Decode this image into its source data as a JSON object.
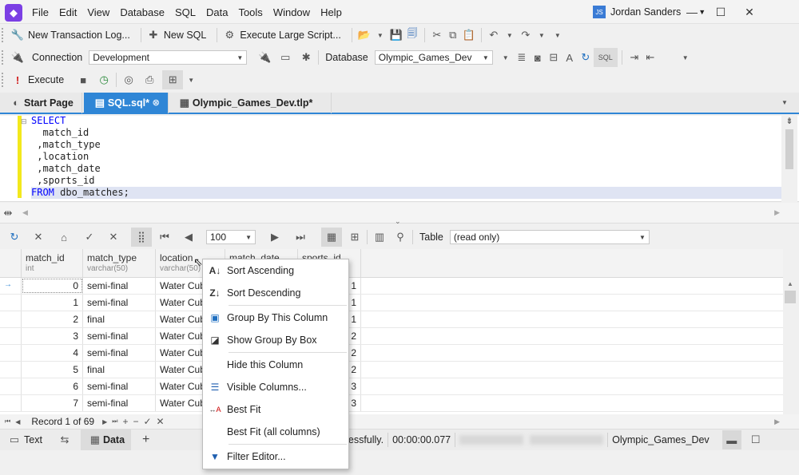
{
  "app": {
    "user": "Jordan Sanders",
    "user_initials": "JS"
  },
  "menu": [
    "File",
    "Edit",
    "View",
    "Database",
    "SQL",
    "Data",
    "Tools",
    "Window",
    "Help"
  ],
  "toolbar1": {
    "new_transaction_log": "New Transaction Log...",
    "new_sql": "New SQL",
    "execute_large_script": "Execute Large Script..."
  },
  "toolbar2": {
    "connection_label": "Connection",
    "connection_value": "Development",
    "database_label": "Database",
    "database_value": "Olympic_Games_Dev"
  },
  "toolbar3": {
    "execute": "Execute"
  },
  "tabs": [
    {
      "label": "Start Page"
    },
    {
      "label": "SQL.sql*"
    },
    {
      "label": "Olympic_Games_Dev.tlp*"
    }
  ],
  "editor": {
    "lines": [
      "SELECT",
      "  match_id",
      " ,match_type",
      " ,location",
      " ,match_date",
      " ,sports_id"
    ]
  },
  "editor_from": {
    "kw": "FROM",
    "rest": " dbo_matches;"
  },
  "grid_toolbar": {
    "page_size": "100",
    "table_label": "Table",
    "table_mode": "(read only)"
  },
  "grid": {
    "columns": [
      {
        "name": "match_id",
        "type": "int"
      },
      {
        "name": "match_type",
        "type": "varchar(50)"
      },
      {
        "name": "location",
        "type": "varchar(50)"
      },
      {
        "name": "match_date",
        "type": ""
      },
      {
        "name": "sports_id",
        "type": ""
      }
    ],
    "rows": [
      {
        "id": "0",
        "type": "semi-final",
        "loc": "Water Cub",
        "sport": "1"
      },
      {
        "id": "1",
        "type": "semi-final",
        "loc": "Water Cub",
        "sport": "1"
      },
      {
        "id": "2",
        "type": "final",
        "loc": "Water Cub",
        "sport": "1"
      },
      {
        "id": "3",
        "type": "semi-final",
        "loc": "Water Cub",
        "sport": "2"
      },
      {
        "id": "4",
        "type": "semi-final",
        "loc": "Water Cub",
        "sport": "2"
      },
      {
        "id": "5",
        "type": "final",
        "loc": "Water Cub",
        "sport": "2"
      },
      {
        "id": "6",
        "type": "semi-final",
        "loc": "Water Cub",
        "sport": "3"
      },
      {
        "id": "7",
        "type": "semi-final",
        "loc": "Water Cub",
        "sport": "3"
      }
    ]
  },
  "navigator": {
    "record": "Record 1 of 69"
  },
  "bottom": {
    "text_tab": "Text",
    "data_tab": "Data",
    "status": "ccessfully.",
    "elapsed": "00:00:00.077",
    "database": "Olympic_Games_Dev"
  },
  "context_menu": [
    "Sort Ascending",
    "Sort Descending",
    "Group By This Column",
    "Show Group By Box",
    "Hide this Column",
    "Visible Columns...",
    "Best Fit",
    "Best Fit (all columns)",
    "Filter Editor..."
  ],
  "colors": {
    "accent": "#2f86d6",
    "keyword": "#0000ff",
    "brand": "#7b3fe4",
    "gutter": "#f3e81d"
  }
}
